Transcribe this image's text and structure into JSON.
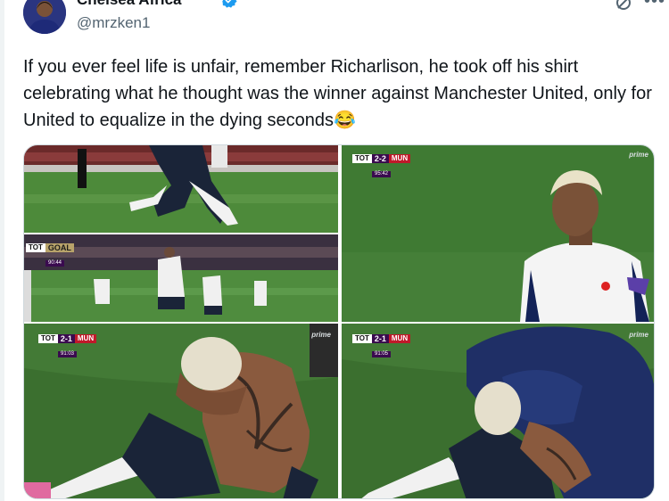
{
  "author": {
    "display_name": "Chelsea Africa",
    "handle": "@mrzken1",
    "verified": true
  },
  "tweet": {
    "text": "If you ever feel life is unfair, remember Richarlison, he took off his shirt celebrating what he thought was the winner against Manchester United, only for United to equalize in the dying seconds😂"
  },
  "media": {
    "panel2": {
      "home": "TOT",
      "score": "2-2",
      "away": "MUN",
      "clock": "95:42",
      "broadcaster": "prime"
    },
    "panel3": {
      "home": "TOT",
      "banner": "GOAL",
      "clock": "90:44"
    },
    "panel4": {
      "home": "TOT",
      "score": "2-1",
      "away": "MUN",
      "clock": "91:03",
      "broadcaster": "prime"
    },
    "panel5": {
      "home": "TOT",
      "score": "2-1",
      "away": "MUN",
      "clock": "91:05",
      "broadcaster": "prime"
    }
  },
  "colors": {
    "accent_verified": "#1d9bf0",
    "pitch": "#3e7a32",
    "spurs_navy": "#132257",
    "scorebug_purple": "#3a0a4f",
    "united_red": "#c0192a"
  }
}
